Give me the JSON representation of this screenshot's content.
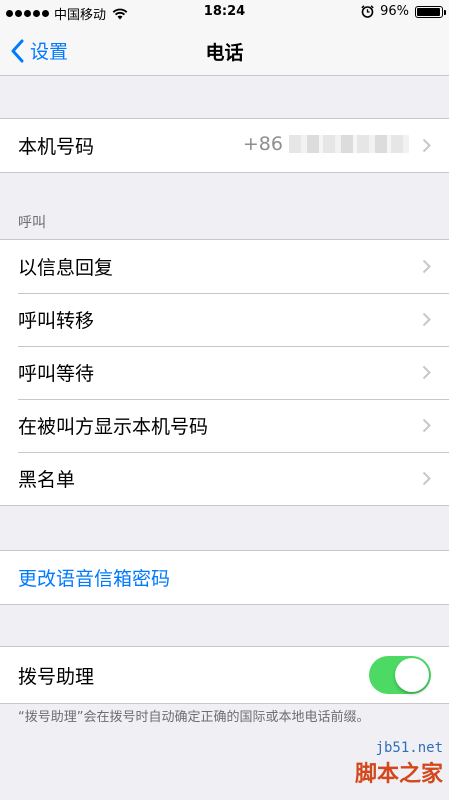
{
  "status_bar": {
    "carrier": "中国移动",
    "time": "18:24",
    "battery": "96%",
    "battery_level": 0.96
  },
  "nav": {
    "back_label": "设置",
    "title": "电话"
  },
  "my_number": {
    "label": "本机号码",
    "value_prefix": "+86"
  },
  "calls_section": {
    "header": "呼叫",
    "items": [
      {
        "label": "以信息回复"
      },
      {
        "label": "呼叫转移"
      },
      {
        "label": "呼叫等待"
      },
      {
        "label": "在被叫方显示本机号码"
      },
      {
        "label": "黑名单"
      }
    ]
  },
  "voicemail": {
    "label": "更改语音信箱密码"
  },
  "dial_assist": {
    "label": "拨号助理",
    "enabled": true,
    "footer": "“拨号助理”会在拨号时自动确定正确的国际或本地电话前缀。"
  },
  "watermark": {
    "url": "jb51.net",
    "name": "脚本之家"
  },
  "colors": {
    "accent": "#007aff",
    "toggle_on": "#4cd964",
    "background": "#efeff4"
  }
}
